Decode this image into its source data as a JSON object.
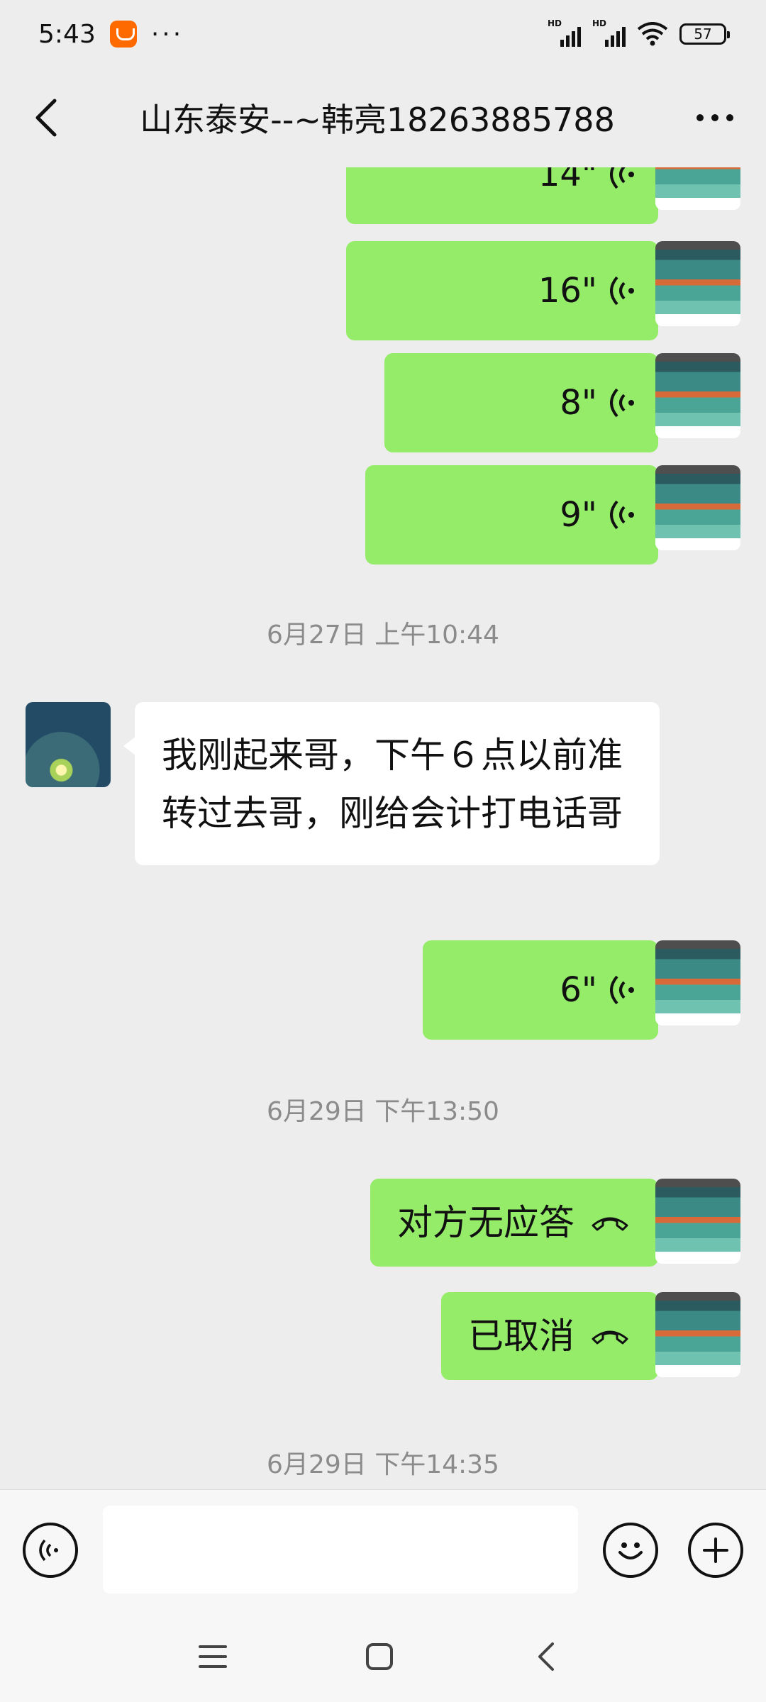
{
  "status_bar": {
    "time": "5:43",
    "dots": "···",
    "signal1_label": "HD",
    "signal2_label": "HD",
    "battery": "57"
  },
  "header": {
    "title": "山东泰安--~韩亮18263885788"
  },
  "messages": {
    "voice1": {
      "duration": "14\""
    },
    "voice2": {
      "duration": "16\""
    },
    "voice3": {
      "duration": "8\""
    },
    "voice4": {
      "duration": "9\""
    },
    "ts1": "6月27日 上午10:44",
    "incoming1": {
      "text": "我刚起来哥，下午６点以前准转过去哥，刚给会计打电话哥"
    },
    "voice5": {
      "duration": "6\""
    },
    "ts2": "6月29日 下午13:50",
    "call1": {
      "text": "对方无应答"
    },
    "call2": {
      "text": "已取消"
    },
    "ts3": "6月29日 下午14:35"
  },
  "input": {
    "placeholder": ""
  },
  "colors": {
    "my_bubble": "#95ec69",
    "their_bubble": "#ffffff",
    "background": "#ededed"
  },
  "icons": {
    "back": "back-chevron-icon",
    "more": "more-dots-icon",
    "voice_wave": "voice-wave-icon",
    "phone": "phone-hangup-icon",
    "voice_toggle": "voice-input-icon",
    "emoji": "emoji-icon",
    "plus": "plus-icon"
  }
}
